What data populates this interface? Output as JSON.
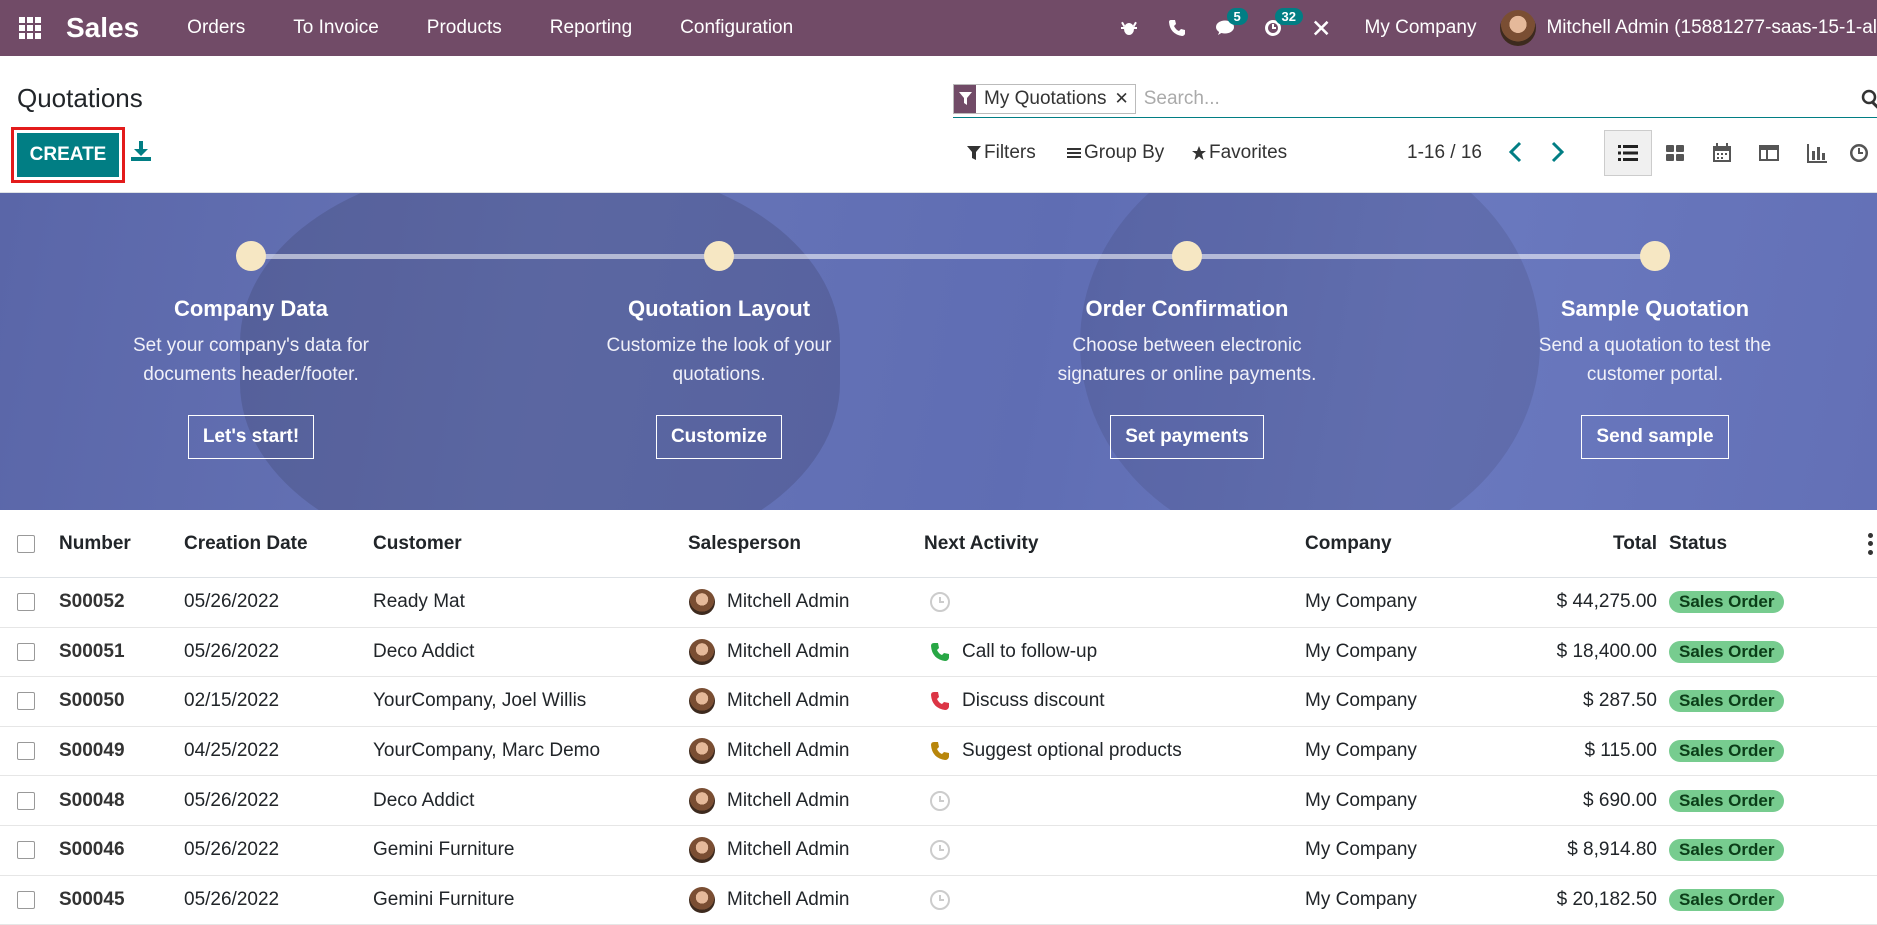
{
  "navbar": {
    "brand": "Sales",
    "menu": [
      "Orders",
      "To Invoice",
      "Products",
      "Reporting",
      "Configuration"
    ],
    "messages_badge": "5",
    "activities_badge": "32",
    "company": "My Company",
    "user": "Mitchell Admin (15881277-saas-15-1-al"
  },
  "control": {
    "title": "Quotations",
    "create_label": "CREATE",
    "facet_label": "My Quotations",
    "search_placeholder": "Search...",
    "filters_label": "Filters",
    "groupby_label": "Group By",
    "favorites_label": "Favorites",
    "pager": "1-16 / 16"
  },
  "banner": {
    "steps": [
      {
        "title": "Company Data",
        "desc1": "Set your company's data for",
        "desc2": "documents header/footer.",
        "button": "Let's start!"
      },
      {
        "title": "Quotation Layout",
        "desc1": "Customize the look of your",
        "desc2": "quotations.",
        "button": "Customize"
      },
      {
        "title": "Order Confirmation",
        "desc1": "Choose between electronic",
        "desc2": "signatures or online payments.",
        "button": "Set payments"
      },
      {
        "title": "Sample Quotation",
        "desc1": "Send a quotation to test the",
        "desc2": "customer portal.",
        "button": "Send sample"
      }
    ]
  },
  "table": {
    "columns": [
      "Number",
      "Creation Date",
      "Customer",
      "Salesperson",
      "Next Activity",
      "Company",
      "Total",
      "Status"
    ],
    "rows": [
      {
        "number": "S00052",
        "date": "05/26/2022",
        "customer": "Ready Mat",
        "salesperson": "Mitchell Admin",
        "activity": "",
        "activity_icon": "clock-icon",
        "activity_color": "#cccccc",
        "company": "My Company",
        "total": "$ 44,275.00",
        "status": "Sales Order"
      },
      {
        "number": "S00051",
        "date": "05/26/2022",
        "customer": "Deco Addict",
        "salesperson": "Mitchell Admin",
        "activity": "Call to follow-up",
        "activity_icon": "phone-icon",
        "activity_color": "#28a745",
        "company": "My Company",
        "total": "$ 18,400.00",
        "status": "Sales Order"
      },
      {
        "number": "S00050",
        "date": "02/15/2022",
        "customer": "YourCompany, Joel Willis",
        "salesperson": "Mitchell Admin",
        "activity": "Discuss discount",
        "activity_icon": "phone-icon",
        "activity_color": "#dc3545",
        "company": "My Company",
        "total": "$ 287.50",
        "status": "Sales Order"
      },
      {
        "number": "S00049",
        "date": "04/25/2022",
        "customer": "YourCompany, Marc Demo",
        "salesperson": "Mitchell Admin",
        "activity": "Suggest optional products",
        "activity_icon": "phone-icon",
        "activity_color": "#b8860b",
        "company": "My Company",
        "total": "$ 115.00",
        "status": "Sales Order"
      },
      {
        "number": "S00048",
        "date": "05/26/2022",
        "customer": "Deco Addict",
        "salesperson": "Mitchell Admin",
        "activity": "",
        "activity_icon": "clock-icon",
        "activity_color": "#cccccc",
        "company": "My Company",
        "total": "$ 690.00",
        "status": "Sales Order"
      },
      {
        "number": "S00046",
        "date": "05/26/2022",
        "customer": "Gemini Furniture",
        "salesperson": "Mitchell Admin",
        "activity": "",
        "activity_icon": "clock-icon",
        "activity_color": "#cccccc",
        "company": "My Company",
        "total": "$ 8,914.80",
        "status": "Sales Order"
      },
      {
        "number": "S00045",
        "date": "05/26/2022",
        "customer": "Gemini Furniture",
        "salesperson": "Mitchell Admin",
        "activity": "",
        "activity_icon": "clock-icon",
        "activity_color": "#cccccc",
        "company": "My Company",
        "total": "$ 20,182.50",
        "status": "Sales Order"
      }
    ]
  },
  "colors": {
    "navbar": "#714B67",
    "primary": "#017e84",
    "status_badge": "#77cc8f",
    "highlight_border": "#e31b1b"
  }
}
